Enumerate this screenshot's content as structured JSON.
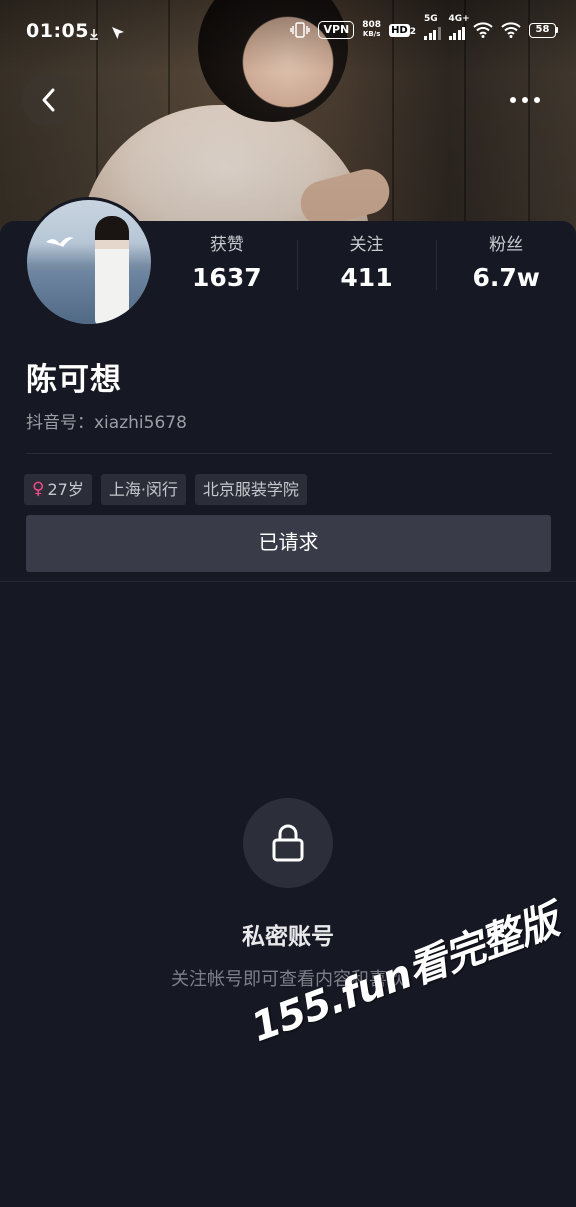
{
  "status_bar": {
    "time": "01:05",
    "vpn": "VPN",
    "net_speed_value": "808",
    "net_speed_unit": "KB/s",
    "hd": "HD",
    "hd_sub": "2",
    "net1": "5G",
    "net2": "4G+",
    "battery": "58"
  },
  "profile": {
    "name": "陈可想",
    "douyin_id": "抖音号：xiazhi5678",
    "stats": [
      {
        "label": "获赞",
        "value": "1637"
      },
      {
        "label": "关注",
        "value": "411"
      },
      {
        "label": "粉丝",
        "value": "6.7w"
      }
    ],
    "tags": {
      "gender_symbol": "♀",
      "age": "27岁",
      "location": "上海·闵行",
      "school": "北京服装学院"
    },
    "request_button": "已请求"
  },
  "private_notice": {
    "title": "私密账号",
    "subtitle": "关注帐号即可查看内容和喜欢"
  },
  "watermark": "155.fun看完整版",
  "colors": {
    "background": "#161823",
    "button": "#393b48",
    "tag_bg": "#2b2d39",
    "female_accent": "#f64a88"
  },
  "icons": [
    "back-arrow-icon",
    "more-dots-icon",
    "lock-icon",
    "female-icon",
    "wifi-icon",
    "signal-icon",
    "battery-icon",
    "vibrate-icon",
    "location-arrow-icon"
  ]
}
